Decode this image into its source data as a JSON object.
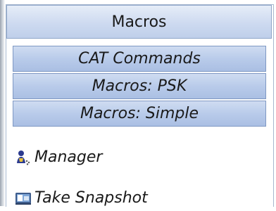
{
  "panel": {
    "title": "Macros"
  },
  "tabs": [
    {
      "label": "CAT Commands"
    },
    {
      "label": "Macros: PSK"
    },
    {
      "label": "Macros: Simple"
    }
  ],
  "items": [
    {
      "label": "Manager",
      "icon": "manager-icon"
    },
    {
      "label": "Take Snapshot",
      "icon": "snapshot-icon"
    }
  ],
  "colors": {
    "header_top": "#e6edf8",
    "header_bottom": "#bfcfea",
    "tab_top": "#cfdcf1",
    "tab_bottom": "#aabfe3",
    "border": "#7f98c3"
  }
}
